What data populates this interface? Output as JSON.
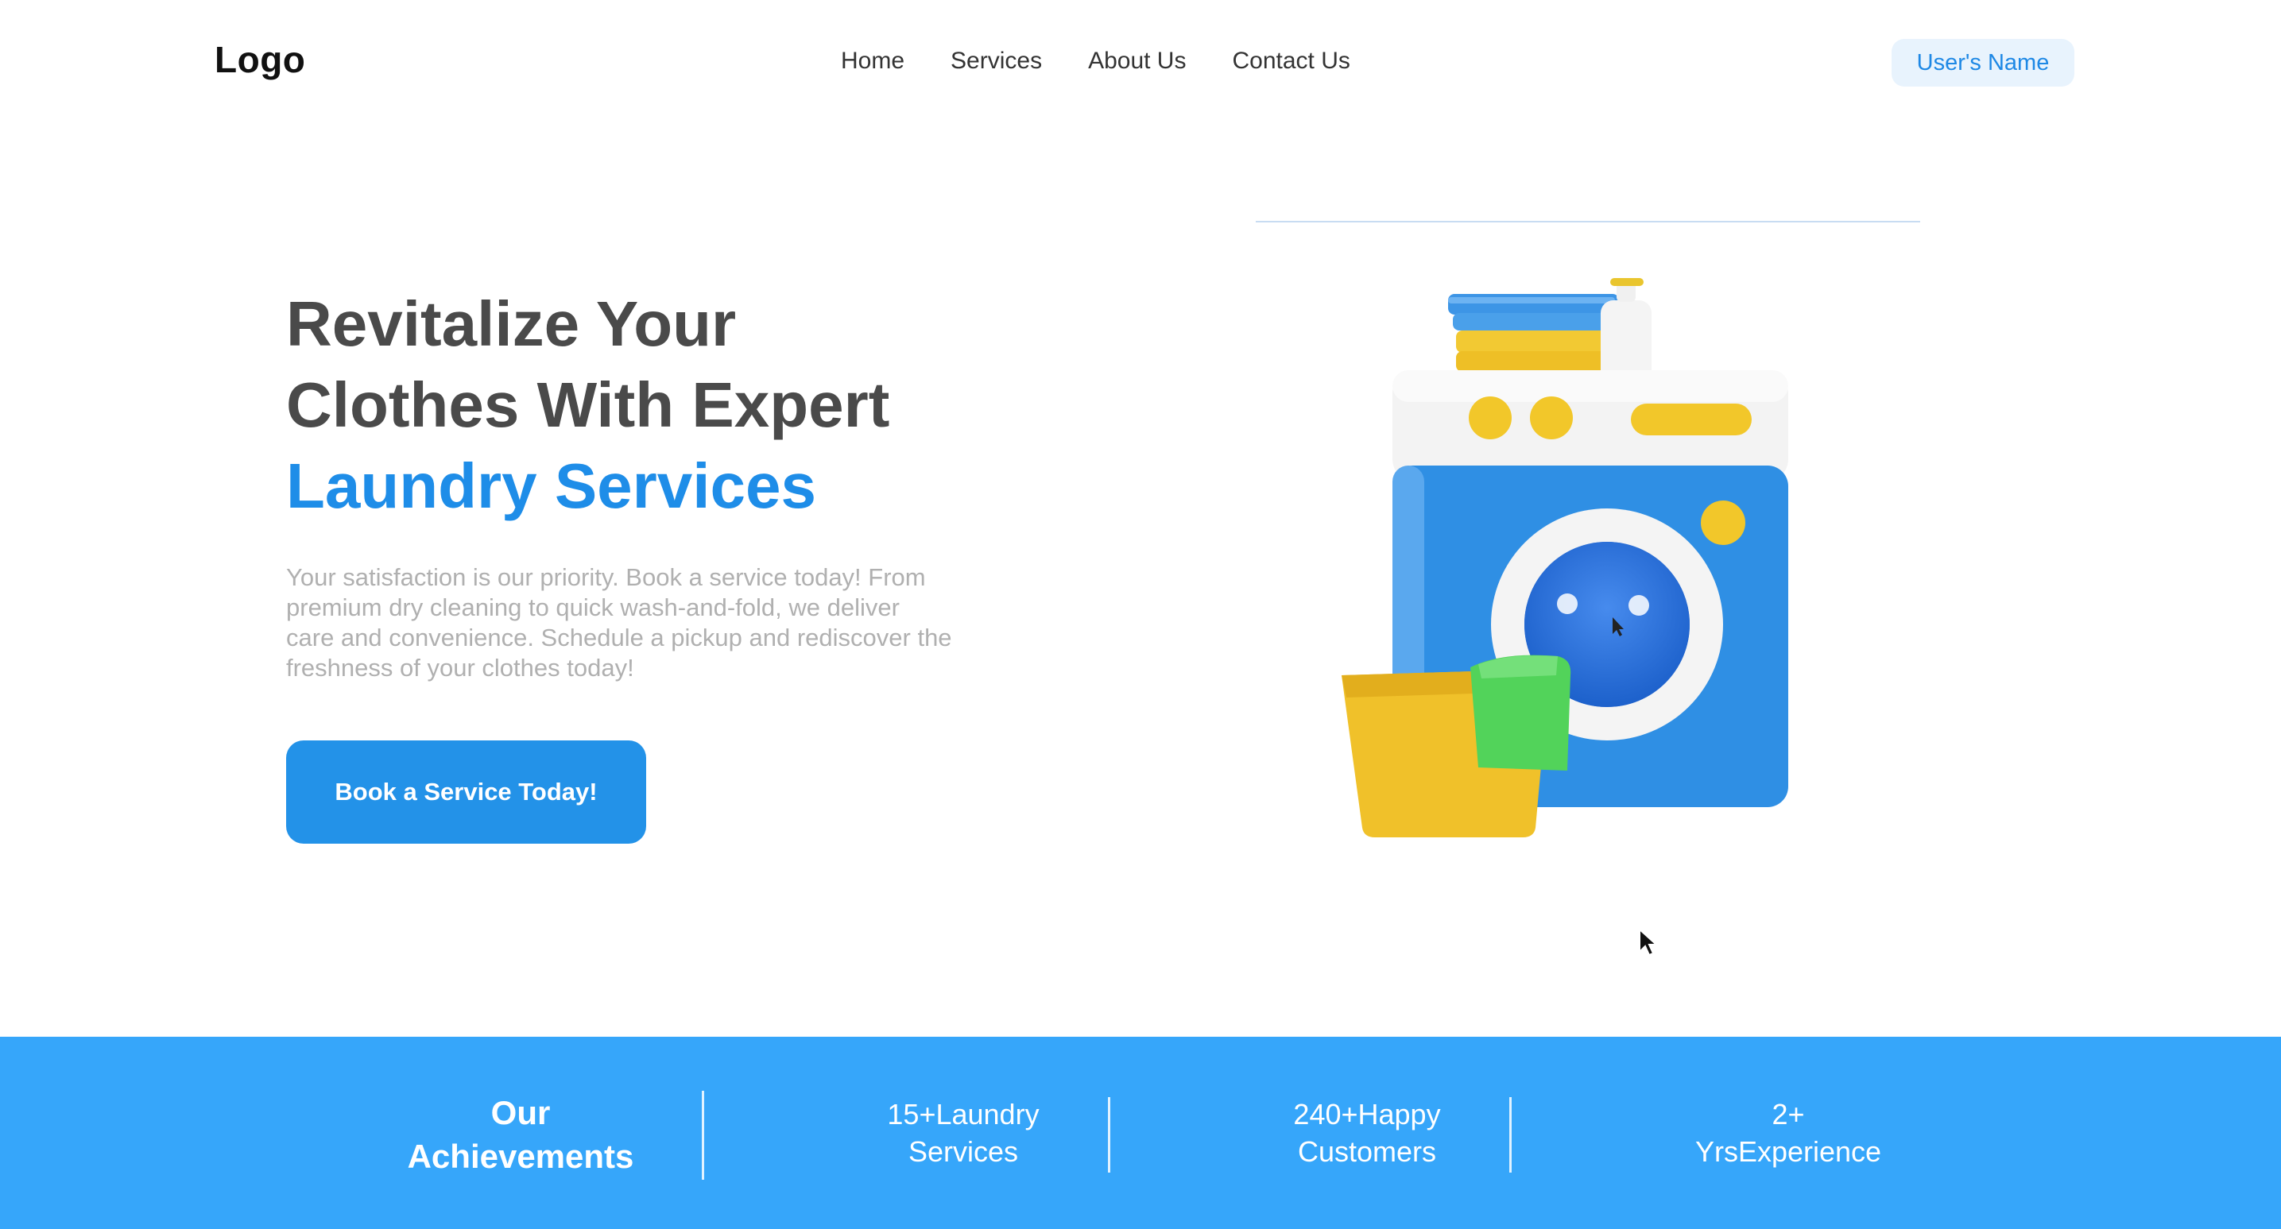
{
  "header": {
    "logo": "Logo",
    "nav": [
      "Home",
      "Services",
      "About Us",
      "Contact Us"
    ],
    "user_name": "User's Name"
  },
  "hero": {
    "line1": "Revitalize Your",
    "line2": "Clothes With Expert",
    "highlight": "Laundry Services",
    "description": "Your satisfaction is our priority. Book a service today! From premium dry cleaning to quick wash-and-fold, we deliver care and convenience. Schedule a pickup and rediscover the freshness of your clothes today!",
    "cta_label": "Book a Service Today!",
    "illustration_icon": "washing-machine-illustration"
  },
  "achievements": {
    "title_line1": "Our",
    "title_line2": "Achievements",
    "stats": [
      {
        "line1": "15+Laundry",
        "line2": "Services"
      },
      {
        "line1": "240+Happy",
        "line2": "Customers"
      },
      {
        "line1": "2+",
        "line2": "YrsExperience"
      }
    ]
  },
  "colors": {
    "accent": "#1e8de8",
    "band": "#36a6fa",
    "heading": "#4a4a4a",
    "muted_text": "#b0b0b0",
    "badge_bg": "#e8f3fd"
  }
}
